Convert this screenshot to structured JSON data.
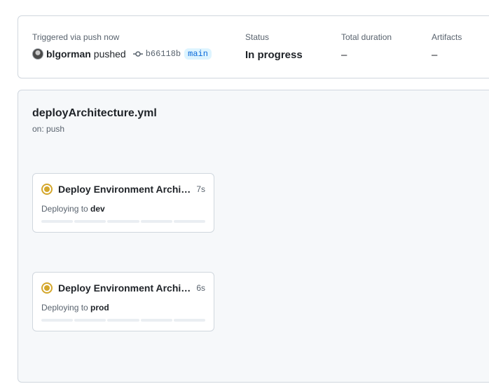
{
  "summary": {
    "triggered_label": "Triggered via push now",
    "actor": "blgorman",
    "verb": "pushed",
    "commit": "b66118b",
    "branch": "main",
    "status_label": "Status",
    "status_value": "In progress",
    "duration_label": "Total duration",
    "duration_value": "–",
    "artifacts_label": "Artifacts",
    "artifacts_value": "–"
  },
  "workflow": {
    "file": "deployArchitecture.yml",
    "trigger": "on: push",
    "jobs": [
      {
        "name": "Deploy Environment Architecture",
        "time": "7s",
        "sub_prefix": "Deploying to",
        "env": "dev",
        "status": "in-progress",
        "status_color": "#d4a72c",
        "step_count": 5
      },
      {
        "name": "Deploy Environment Architecture",
        "time": "6s",
        "sub_prefix": "Deploying to",
        "env": "prod",
        "status": "in-progress",
        "status_color": "#d4a72c",
        "step_count": 5
      }
    ]
  },
  "icons": {
    "status": "in-progress-dot-icon",
    "commit": "git-commit-icon",
    "avatar": "user-avatar"
  }
}
